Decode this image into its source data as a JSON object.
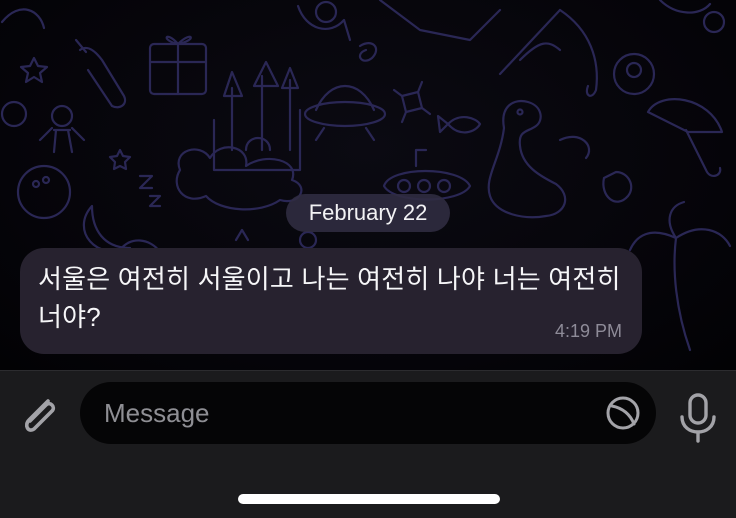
{
  "chat": {
    "date_separator": "February 22",
    "messages": [
      {
        "text": "서울은 여전히 서울이고 나는 여전히 나야 너는 여전히 너야?",
        "time": "4:19 PM"
      }
    ]
  },
  "composer": {
    "placeholder": "Message",
    "value": "",
    "attach_icon": "paperclip-icon",
    "sticker_icon": "sticker-icon",
    "mic_icon": "microphone-icon"
  },
  "colors": {
    "background": "#000000",
    "bubble": "#27222f",
    "input_bar": "#1b1b1d",
    "doodle": "#2a2755"
  }
}
